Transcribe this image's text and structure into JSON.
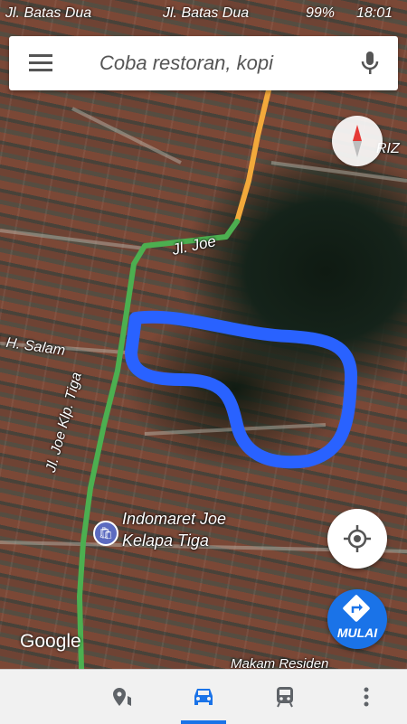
{
  "status_bar": {
    "left_label": "Jl. Batas Dua",
    "center_label": "Jl. Batas Dua",
    "battery": "99%",
    "time": "18:01"
  },
  "search": {
    "placeholder": "Coba restoran, kopi"
  },
  "map": {
    "labels": {
      "jl_joe": "Jl. Joe",
      "h_salam": "Jl. H. Salam",
      "jl_joe_klp_tiga": "Jl. Joe Klp. Tiga",
      "indomaret_line1": "Indomaret Joe",
      "indomaret_line2": "Kelapa Tiga",
      "riz": "RIZ",
      "makam": "Makam Residen"
    },
    "route_color": "#4caf50",
    "traffic_color": "#f2a93b",
    "highlight_color": "#2962ff"
  },
  "buttons": {
    "start_label": "MULAI"
  },
  "attribution": "Google",
  "bottom_nav": {
    "tabs": [
      {
        "name": "explore"
      },
      {
        "name": "driving"
      },
      {
        "name": "transit"
      },
      {
        "name": "more"
      }
    ]
  },
  "colors": {
    "accent": "#1a73e8"
  }
}
